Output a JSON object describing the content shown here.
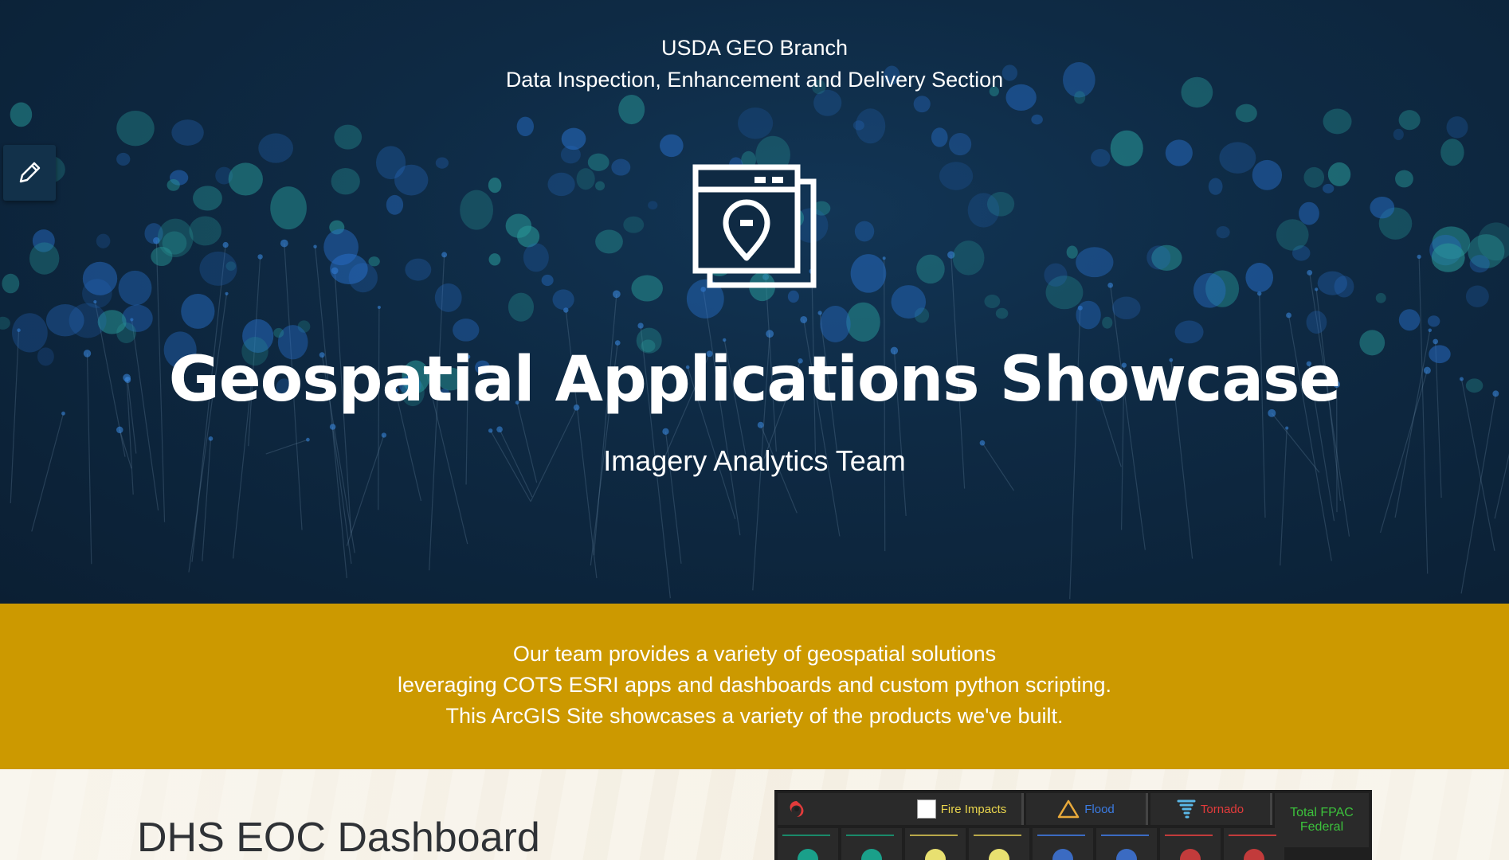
{
  "header": {
    "org_line1": "USDA GEO Branch",
    "org_line2": "Data Inspection, Enhancement and Delivery Section"
  },
  "hero": {
    "title": "Geospatial Applications Showcase",
    "subtitle": "Imagery Analytics Team",
    "logo_icon": "web-map-app-icon",
    "edit_icon": "pencil-icon"
  },
  "intro_band": {
    "line1": "Our team provides a variety of geospatial solutions",
    "line2": "leveraging COTS ESRI apps and dashboards  and custom python scripting.",
    "line3": "This ArcGIS Site showcases a variety of the products we've built.",
    "color": "#cc9900"
  },
  "featured": {
    "title": "DHS EOC Dashboard",
    "dashboard_preview": {
      "tabs": [
        {
          "label": "",
          "icon": "hurricane-icon",
          "color": "#e23b3b"
        },
        {
          "label": "Fire Impacts",
          "icon": "broken-image-icon",
          "color": "#e8d44d"
        },
        {
          "label": "Flood",
          "icon": "warning-triangle-icon",
          "color": "#3b7be2"
        },
        {
          "label": "Tornado",
          "icon": "tornado-icon",
          "color": "#e23b3b"
        },
        {
          "label": "Total FPAC Federal",
          "icon": "",
          "color": "#3cc23c"
        }
      ]
    }
  },
  "colors": {
    "hero_bg": "#0d2236",
    "text": "#ffffff",
    "card_title": "#2f3236"
  }
}
